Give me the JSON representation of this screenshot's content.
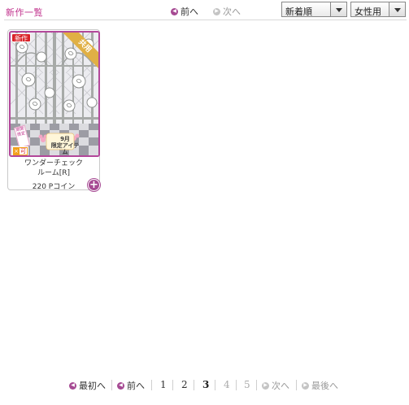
{
  "header": {
    "title": "新作一覧",
    "prev_label": "前へ",
    "next_label": "次へ",
    "sort_value": "新着順",
    "gender_value": "女性用"
  },
  "card": {
    "new_badge": "新作",
    "ribbon": "共用",
    "month_line1": "9月",
    "month_line2": "限定アイテム",
    "limited_tag": "期間限定",
    "cert_badge_icon": "×",
    "cert_badge_text": "可",
    "name_line1": "ワンダーチェック",
    "name_line2": "ルーム[R]",
    "price": "220 Pコイン",
    "add_icon": "plus-icon"
  },
  "pagination": {
    "first_label": "最初へ",
    "prev_label": "前へ",
    "pages": [
      "1",
      "2",
      "3",
      "4",
      "5"
    ],
    "current_page": "3",
    "next_label": "次へ",
    "last_label": "最後へ"
  },
  "colors": {
    "accent": "#a64a93",
    "title": "#c0308c",
    "new_badge": "#d9232a",
    "ribbon": "#e0b045"
  }
}
